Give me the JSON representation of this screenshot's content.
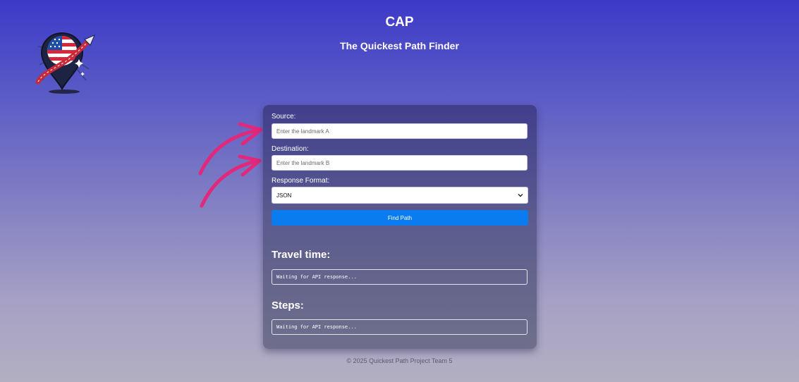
{
  "header": {
    "title": "CAP",
    "subtitle": "The Quickest Path Finder"
  },
  "form": {
    "source_label": "Source:",
    "source_placeholder": "Enter the landmark A",
    "source_value": "",
    "destination_label": "Destination:",
    "destination_placeholder": "Enter the landmark B",
    "destination_value": "",
    "format_label": "Response Format:",
    "format_selected": "JSON",
    "submit_label": "Find Path"
  },
  "results": {
    "travel_time_heading": "Travel time:",
    "travel_time_value": "Waiting for API response...",
    "steps_heading": "Steps:",
    "steps_value": "Waiting for API response..."
  },
  "footer": {
    "text": "© 2025 Quickest Path Project Team 5"
  },
  "colors": {
    "accent": "#0a7cf0",
    "arrow": "#e2287a",
    "header_text": "#ffffff"
  },
  "icons": {
    "logo": "map-pin-usa-flag-logo",
    "arrows": "pink-pointer-arrows",
    "select": "chevron-down-icon"
  }
}
